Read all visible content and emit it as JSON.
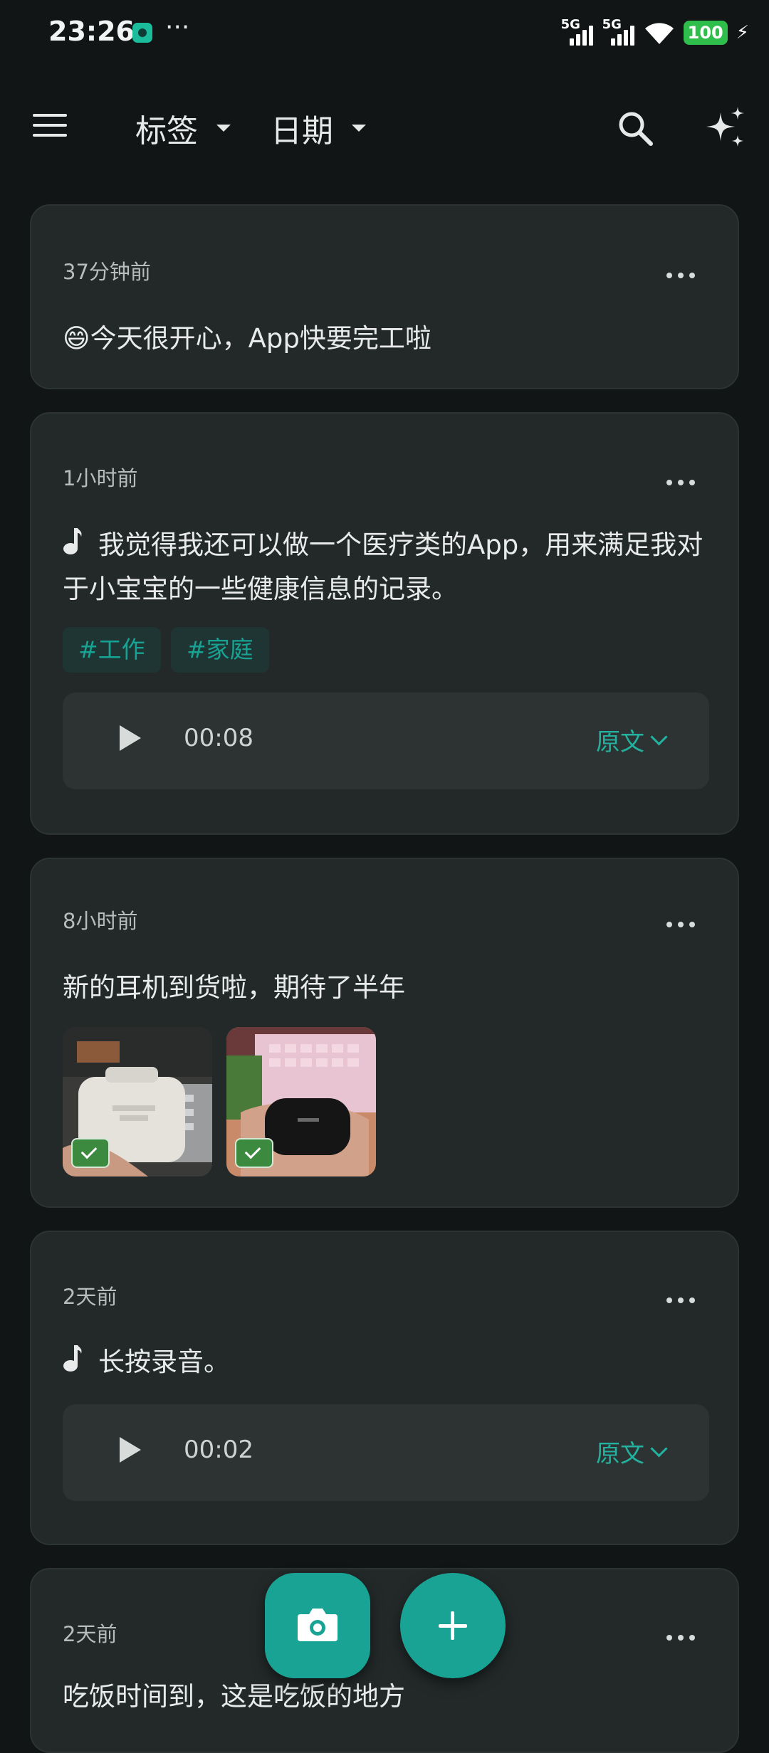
{
  "status_bar": {
    "time": "23:26",
    "more": "···",
    "network_1": "5G",
    "network_2": "5G",
    "battery": "100"
  },
  "top_bar": {
    "tags_dropdown": "标签",
    "date_dropdown": "日期",
    "icons": [
      "menu-icon",
      "search-icon",
      "sparkle-icon"
    ]
  },
  "notes": [
    {
      "time": "37分钟前",
      "text": "😄今天很开心，App快要完工啦"
    },
    {
      "time": "1小时前",
      "text": "我觉得我还可以做一个医疗类的App，用来满足我对于小宝宝的一些健康信息的记录。",
      "tags": [
        "#工作",
        "#家庭"
      ],
      "audio": {
        "duration": "00:08",
        "original_label": "原文"
      }
    },
    {
      "time": "8小时前",
      "text": "新的耳机到货啦，期待了半年",
      "image_count": 2
    },
    {
      "time": "2天前",
      "text": "长按录音。",
      "audio": {
        "duration": "00:02",
        "original_label": "原文"
      }
    },
    {
      "time": "2天前",
      "text": "吃饭时间到，这是吃饭的地方"
    }
  ],
  "colors": {
    "background": "#111515",
    "card": "#232929",
    "accent": "#19a394",
    "tag_text": "#17a394",
    "check_badge": "#3c8a3f",
    "battery": "#2fbd4b"
  }
}
